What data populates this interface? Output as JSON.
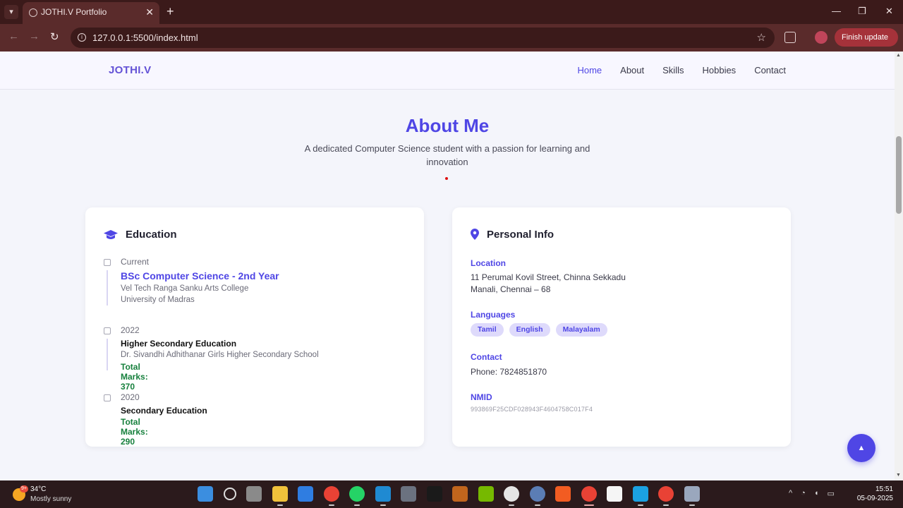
{
  "browser": {
    "tab_title": "JOTHI.V Portfolio",
    "url": "127.0.0.1:5500/index.html",
    "finish_update": "Finish update"
  },
  "site": {
    "logo": "JOTHI.V",
    "nav": [
      "Home",
      "About",
      "Skills",
      "Hobbies",
      "Contact"
    ],
    "active_nav": "Home"
  },
  "about": {
    "title": "About Me",
    "subtitle": "A dedicated Computer Science student with a passion for learning and innovation"
  },
  "education": {
    "heading": "Education",
    "items": [
      {
        "year": "Current",
        "degree": "BSc Computer Science - 2nd Year",
        "lines": [
          "Vel Tech Ranga Sanku Arts College",
          "University of Madras"
        ]
      },
      {
        "year": "2022",
        "degree": "Higher Secondary Education",
        "lines": [
          "Dr. Sivandhi Adhithanar Girls Higher Secondary School"
        ],
        "marks": "Total Marks: 370"
      },
      {
        "year": "2020",
        "degree": "Secondary Education",
        "marks": "Total Marks: 290"
      }
    ]
  },
  "personal": {
    "heading": "Personal Info",
    "location_label": "Location",
    "location_line1": "11 Perumal Kovil Street, Chinna Sekkadu",
    "location_line2": "Manali, Chennai – 68",
    "languages_label": "Languages",
    "languages": [
      "Tamil",
      "English",
      "Malayalam"
    ],
    "contact_label": "Contact",
    "phone": "Phone: 7824851870",
    "nmid_label": "NMID",
    "nmid": "993869F25CDF028943F4604758C017F4"
  },
  "taskbar": {
    "weather_badge": "9+",
    "temperature": "34°C",
    "condition": "Mostly sunny",
    "time": "15:51",
    "date": "05-09-2025"
  },
  "colors": {
    "accent": "#4f46e5",
    "marks_green": "#17803d",
    "chip_bg": "#dedafb"
  }
}
